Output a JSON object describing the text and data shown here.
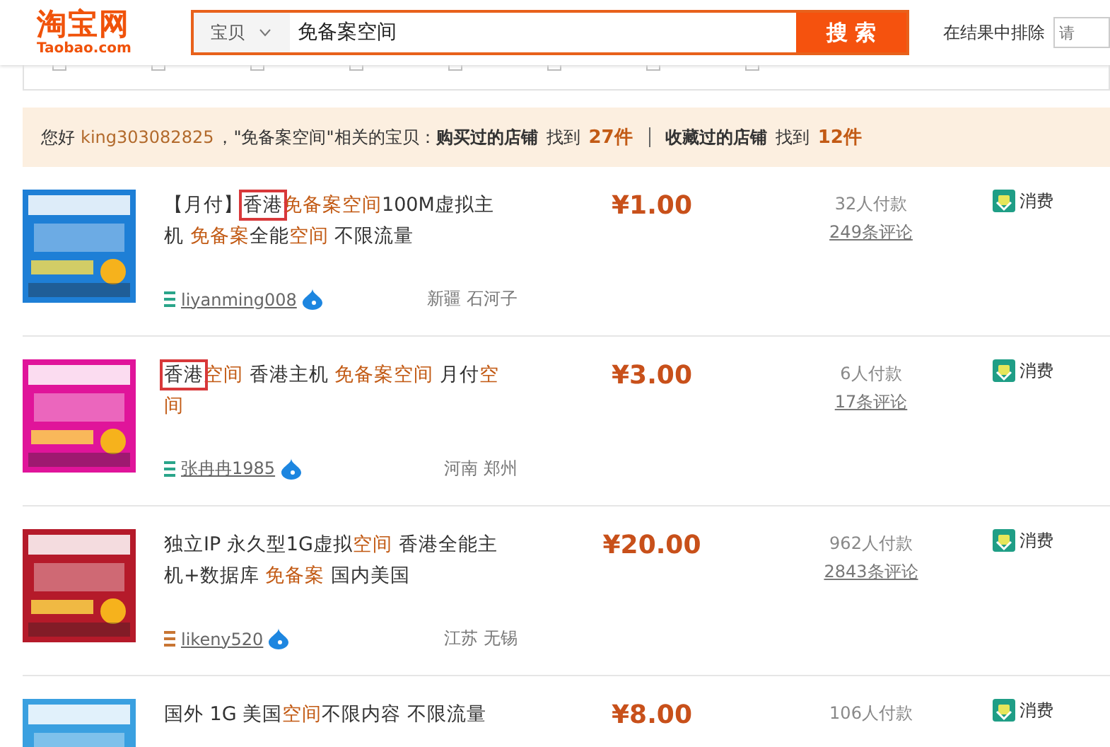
{
  "header": {
    "logo": "淘宝网",
    "logo_sub": "Taobao.com",
    "search": {
      "category": "宝贝",
      "value": "免备案空间",
      "button": "搜 索"
    },
    "exclude_label": "在结果中排除",
    "exclude_placeholder": "请"
  },
  "notice": {
    "greeting": "您好",
    "user": "king303082825",
    "query_text": "，\"免备案空间\"相关的宝贝：",
    "groups": [
      {
        "label": "购买过的店铺",
        "found": "找到",
        "count": "27件"
      },
      {
        "label": "收藏过的店铺",
        "found": "找到",
        "count": "12件"
      }
    ]
  },
  "items": [
    {
      "title": [
        {
          "text": "【月付】",
          "highlight": false,
          "boxed": false
        },
        {
          "text": "香港",
          "highlight": false,
          "boxed": true
        },
        {
          "text": "免备案空间",
          "highlight": true,
          "boxed": false
        },
        {
          "text": "100M虚拟主机 ",
          "highlight": false,
          "boxed": false
        },
        {
          "text": "免备案",
          "highlight": true,
          "boxed": false
        },
        {
          "text": "全能",
          "highlight": false,
          "boxed": false
        },
        {
          "text": "空间",
          "highlight": true,
          "boxed": false
        },
        {
          "text": " 不限流量",
          "highlight": false,
          "boxed": false
        }
      ],
      "price": "¥1.00",
      "sales": "32人付款",
      "reviews": "249条评论",
      "seller": "liyanming008",
      "color": "#2aa58a",
      "location": "新疆 石河子",
      "badge": "消费"
    },
    {
      "title": [
        {
          "text": "香港",
          "highlight": false,
          "boxed": true
        },
        {
          "text": "空间",
          "highlight": true,
          "boxed": false
        },
        {
          "text": " 香港主机 ",
          "highlight": false,
          "boxed": false
        },
        {
          "text": "免备案空间",
          "highlight": true,
          "boxed": false
        },
        {
          "text": " 月付",
          "highlight": false,
          "boxed": false
        },
        {
          "text": "空间",
          "highlight": true,
          "boxed": false
        }
      ],
      "price": "¥3.00",
      "sales": "6人付款",
      "reviews": "17条评论",
      "seller": "张冉冉1985",
      "color": "#2aa58a",
      "location": "河南 郑州",
      "badge": "消费"
    },
    {
      "title": [
        {
          "text": "独立IP 永久型1G虚拟",
          "highlight": false,
          "boxed": false
        },
        {
          "text": "空间",
          "highlight": true,
          "boxed": false
        },
        {
          "text": " 香港全能主机+数据库 ",
          "highlight": false,
          "boxed": false
        },
        {
          "text": "免备案",
          "highlight": true,
          "boxed": false
        },
        {
          "text": " 国内美国",
          "highlight": false,
          "boxed": false
        }
      ],
      "price": "¥20.00",
      "sales": "962人付款",
      "reviews": "2843条评论",
      "seller": "likeny520",
      "color": "#c87533",
      "location": "江苏 无锡",
      "badge": "消费"
    },
    {
      "title": [
        {
          "text": "国外 1G 美国",
          "highlight": false,
          "boxed": false
        },
        {
          "text": "空间",
          "highlight": true,
          "boxed": false
        },
        {
          "text": "不限内容 不限流量",
          "highlight": false,
          "boxed": false
        }
      ],
      "price": "¥8.00",
      "sales": "106人付款",
      "badge": "消费"
    }
  ]
}
